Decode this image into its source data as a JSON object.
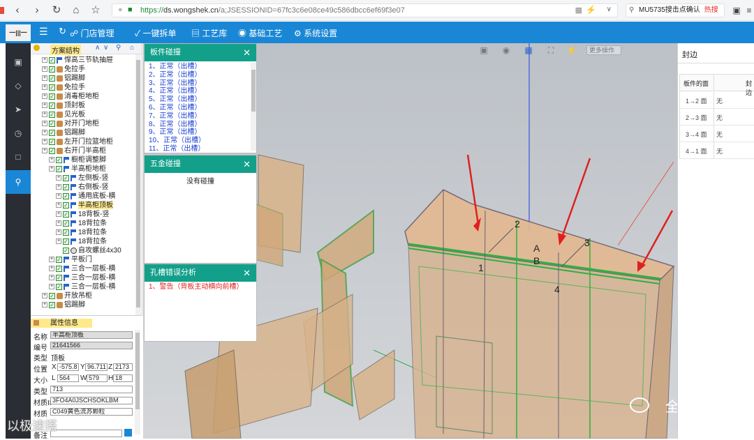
{
  "browser": {
    "url_prefix": "https://",
    "url_domain": "ds.wongshek.cn",
    "url_rest": "/a;JSESSIONID=67fc3c6e08ce49c586dbcc6ef69f3e07",
    "search_text": "MU5735搜击点确认",
    "hot_label": "热搜"
  },
  "appbar": {
    "logo_text": "一|||一",
    "menu": [
      "门店管理",
      "一键拆单",
      "工艺库",
      "基础工艺",
      "系统设置"
    ]
  },
  "tree": {
    "header": "方案结构",
    "rows": [
      {
        "label": "悍高三节轨抽屉",
        "depth": 1,
        "icon": "flag"
      },
      {
        "label": "免拉手",
        "depth": 1,
        "icon": "box"
      },
      {
        "label": "铝踢脚",
        "depth": 1,
        "icon": "box"
      },
      {
        "label": "免拉手",
        "depth": 1,
        "icon": "box"
      },
      {
        "label": "消毒柜地柜",
        "depth": 1,
        "icon": "box"
      },
      {
        "label": "顶封板",
        "depth": 1,
        "icon": "box"
      },
      {
        "label": "见光板",
        "depth": 1,
        "icon": "box"
      },
      {
        "label": "对开门地柜",
        "depth": 1,
        "icon": "box"
      },
      {
        "label": "铝踢脚",
        "depth": 1,
        "icon": "box"
      },
      {
        "label": "左开门拉篮地柜",
        "depth": 1,
        "icon": "box"
      },
      {
        "label": "右开门半高柜",
        "depth": 1,
        "icon": "box"
      },
      {
        "label": "橱柜调整脚",
        "depth": 2,
        "icon": "flag"
      },
      {
        "label": "半高柜地柜",
        "depth": 2,
        "icon": "flag"
      },
      {
        "label": "左侧板-竖",
        "depth": 3,
        "icon": "flag"
      },
      {
        "label": "右侧板-竖",
        "depth": 3,
        "icon": "flag"
      },
      {
        "label": "通用底板-横",
        "depth": 3,
        "icon": "flag"
      },
      {
        "label": "半高柜顶板",
        "depth": 3,
        "icon": "flag",
        "selected": true
      },
      {
        "label": "18背板-竖",
        "depth": 3,
        "icon": "flag"
      },
      {
        "label": "18背拉条",
        "depth": 3,
        "icon": "flag"
      },
      {
        "label": "18背拉条",
        "depth": 3,
        "icon": "flag"
      },
      {
        "label": "18背拉条",
        "depth": 3,
        "icon": "flag"
      },
      {
        "label": "自攻螺丝4x30",
        "depth": 3,
        "icon": "screw"
      },
      {
        "label": "平板门",
        "depth": 2,
        "icon": "flag"
      },
      {
        "label": "三合一层板-横",
        "depth": 2,
        "icon": "flag"
      },
      {
        "label": "三合一层板-横",
        "depth": 2,
        "icon": "flag"
      },
      {
        "label": "三合一层板-横",
        "depth": 2,
        "icon": "flag"
      },
      {
        "label": "开放吊柜",
        "depth": 1,
        "icon": "box"
      },
      {
        "label": "铝踢脚",
        "depth": 1,
        "icon": "box"
      }
    ]
  },
  "props": {
    "header": "属性信息",
    "name_label": "名称",
    "name": "半高柜顶板",
    "code_label": "编号",
    "code": "21641566",
    "type_label": "类型",
    "type": "顶板",
    "pos_label": "位置",
    "x": "-575.8",
    "y": "96.711",
    "z": "2173",
    "size_label": "大小",
    "l": "564",
    "w": "579",
    "h": "18",
    "type2_label": "类型",
    "type2": "713",
    "mat_label": "材质II",
    "mat": "3FO4A0JSCHSOKLBM",
    "mat2_label": "材质",
    "mat2": "C049黄色流苏颗粒",
    "note_label": "备注"
  },
  "panels": {
    "collision": {
      "title": "板件碰撞",
      "items": [
        "1、正常（出槽）",
        "2、正常（出槽）",
        "3、正常（出槽）",
        "4、正常（出槽）",
        "5、正常（出槽）",
        "6、正常（出槽）",
        "7、正常（出槽）",
        "8、正常（出槽）",
        "9、正常（出槽）",
        "10、正常（出槽）",
        "11、正常（出槽）"
      ]
    },
    "hardware": {
      "title": "五金碰撞",
      "empty": "没有碰撞"
    },
    "hole": {
      "title": "孔槽错误分析",
      "items": [
        "1、警告（背板主动横向前槽）"
      ]
    }
  },
  "toolbar": {
    "more_label": "更多操作"
  },
  "viewport": {
    "annotations": [
      "1",
      "2",
      "3",
      "4",
      "A",
      "B"
    ]
  },
  "right_panel": {
    "title": "封边",
    "col1": "板件的面",
    "col2": "封边",
    "rows": [
      {
        "face": "1→2 面",
        "edge": "无"
      },
      {
        "face": "2→3 面",
        "edge": "无"
      },
      {
        "face": "3→4 面",
        "edge": "无"
      },
      {
        "face": "4→1 面",
        "edge": "无"
      }
    ]
  },
  "watermark": {
    "text": "全屋E柜",
    "left_text": "以极速搭"
  },
  "colors": {
    "accent": "#1a87d6",
    "panel_head": "#12a08a",
    "warning": "#e02020",
    "link": "#1a3fd1"
  }
}
